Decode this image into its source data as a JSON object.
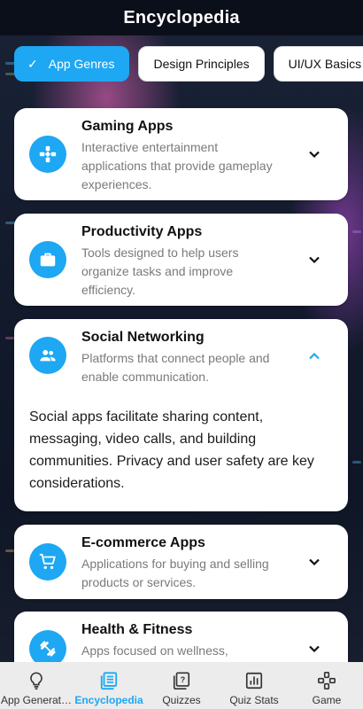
{
  "app": {
    "title": "Encyclopedia"
  },
  "chips": [
    {
      "label": "App Genres",
      "selected": true
    },
    {
      "label": "Design Principles",
      "selected": false
    },
    {
      "label": "UI/UX Basics",
      "selected": false
    }
  ],
  "cards": [
    {
      "title": "Gaming Apps",
      "description": "Interactive entertainment applications that provide gameplay experiences.",
      "icon": "gamepad-icon",
      "expanded": false
    },
    {
      "title": "Productivity Apps",
      "description": "Tools designed to help users organize tasks and improve efficiency.",
      "icon": "briefcase-icon",
      "expanded": false
    },
    {
      "title": "Social Networking",
      "description": "Platforms that connect people and enable communication.",
      "icon": "people-icon",
      "expanded": true,
      "details": "Social apps facilitate sharing content, messaging, video calls, and building communities. Privacy and user safety are key considerations."
    },
    {
      "title": "E-commerce Apps",
      "description": "Applications for buying and selling products or services.",
      "icon": "cart-icon",
      "expanded": false
    },
    {
      "title": "Health & Fitness",
      "description": "Apps focused on wellness,",
      "icon": "dumbbell-icon",
      "expanded": false
    }
  ],
  "bottom_nav": [
    {
      "label": "App Generat…",
      "icon": "lightbulb-icon",
      "active": false
    },
    {
      "label": "Encyclopedia",
      "icon": "book-icon",
      "active": true
    },
    {
      "label": "Quizzes",
      "icon": "quiz-icon",
      "active": false
    },
    {
      "label": "Quiz Stats",
      "icon": "stats-icon",
      "active": false
    },
    {
      "label": "Game",
      "icon": "game-icon",
      "active": false
    }
  ],
  "colors": {
    "accent": "#1ea7f2",
    "topbar": "#0b0f1a",
    "card": "#ffffff",
    "nav": "#ececec"
  }
}
